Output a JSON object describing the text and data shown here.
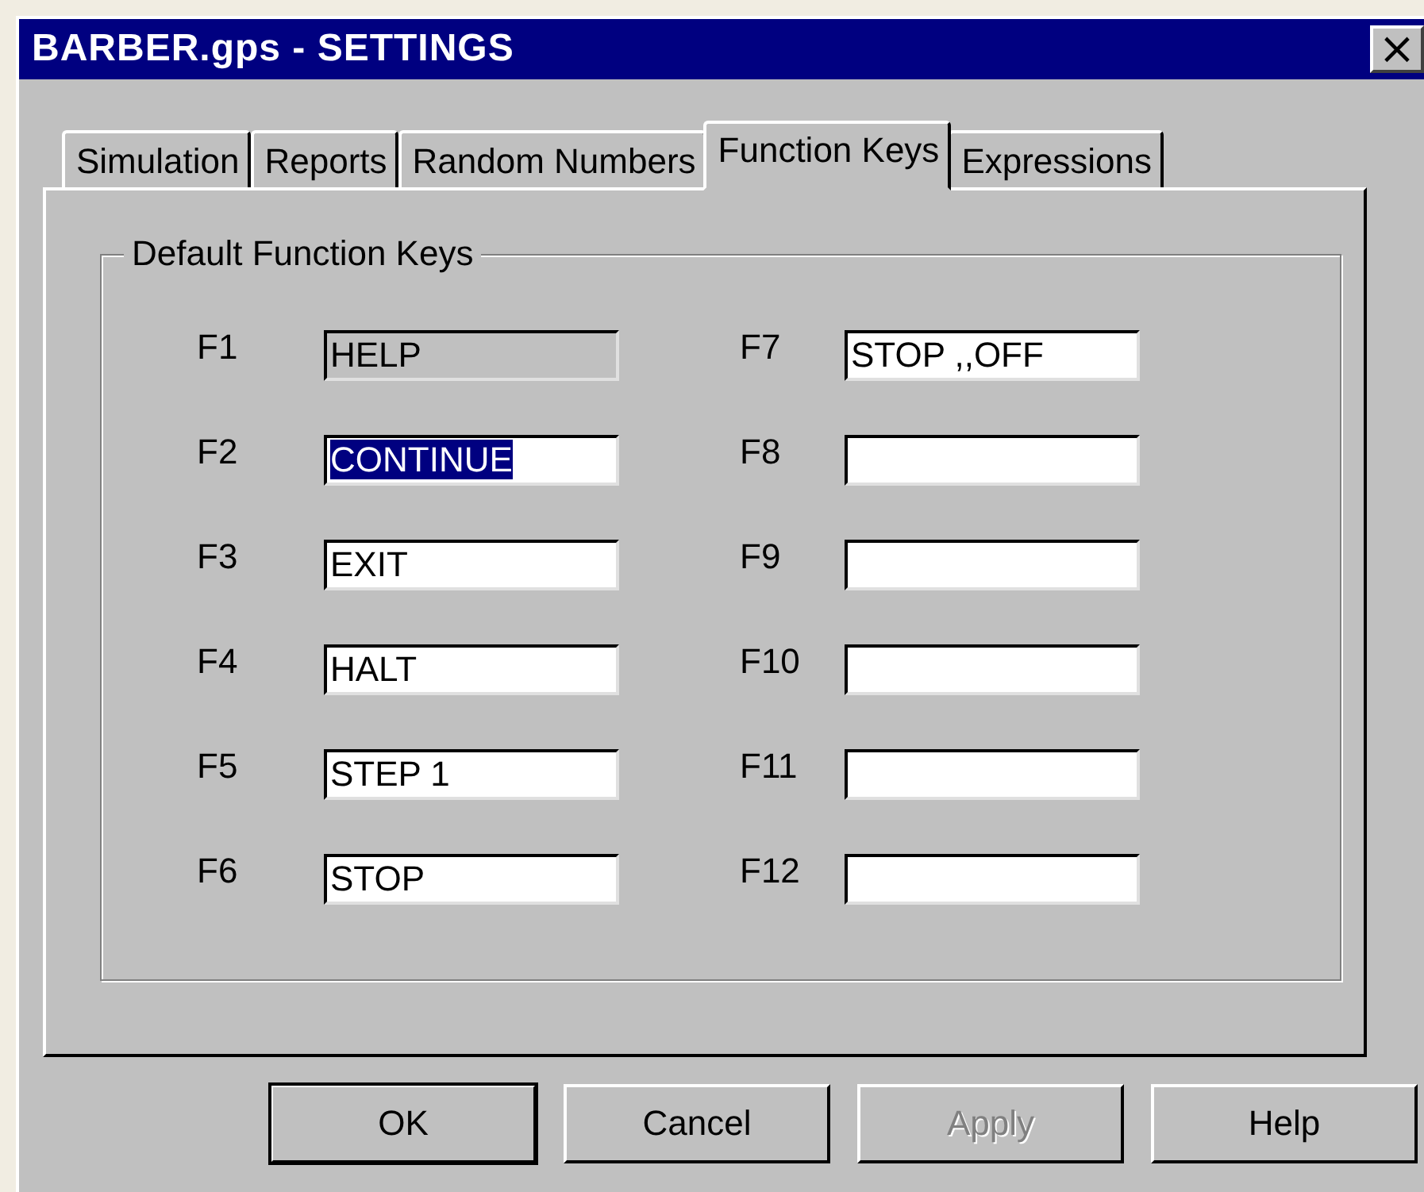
{
  "window": {
    "title": "BARBER.gps - SETTINGS",
    "close": "×"
  },
  "tabs": [
    {
      "label": "Simulation",
      "selected": false
    },
    {
      "label": "Reports",
      "selected": false
    },
    {
      "label": "Random Numbers",
      "selected": false
    },
    {
      "label": "Function Keys",
      "selected": true
    },
    {
      "label": "Expressions",
      "selected": false
    }
  ],
  "group": {
    "title": "Default Function Keys"
  },
  "keys": [
    {
      "label": "F1",
      "value": "HELP",
      "disabled": true,
      "selected": false
    },
    {
      "label": "F2",
      "value": "CONTINUE",
      "disabled": false,
      "selected": true
    },
    {
      "label": "F3",
      "value": "EXIT",
      "disabled": false,
      "selected": false
    },
    {
      "label": "F4",
      "value": "HALT",
      "disabled": false,
      "selected": false
    },
    {
      "label": "F5",
      "value": "STEP 1",
      "disabled": false,
      "selected": false
    },
    {
      "label": "F6",
      "value": "STOP",
      "disabled": false,
      "selected": false
    },
    {
      "label": "F7",
      "value": "STOP ,,OFF",
      "disabled": false,
      "selected": false
    },
    {
      "label": "F8",
      "disabled": false,
      "selected": false
    },
    {
      "label": "F9",
      "disabled": false,
      "selected": false
    },
    {
      "label": "F10",
      "disabled": false,
      "selected": false
    },
    {
      "label": "F11",
      "disabled": false,
      "selected": false
    },
    {
      "label": "F12",
      "disabled": false,
      "selected": false
    }
  ],
  "buttons": [
    {
      "label": "OK",
      "default": true,
      "disabled": false
    },
    {
      "label": "Cancel",
      "default": false,
      "disabled": false
    },
    {
      "label": "Apply",
      "default": false,
      "disabled": true
    },
    {
      "label": "Help",
      "default": false,
      "disabled": false
    }
  ]
}
